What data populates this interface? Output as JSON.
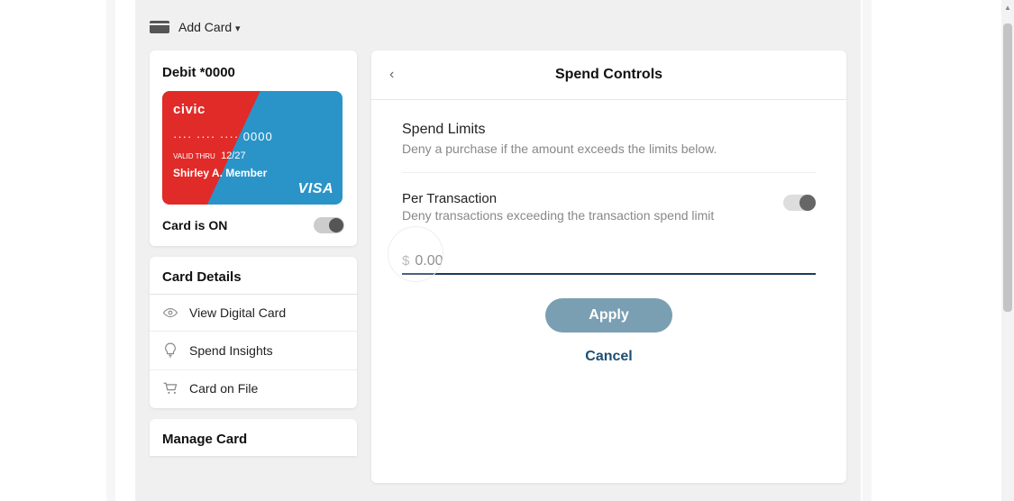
{
  "topbar": {
    "add_card_label": "Add Card"
  },
  "card": {
    "title": "Debit *0000",
    "brand": "civic",
    "number": "···· ···· ···· 0000",
    "valid_label": "VALID\nTHRU",
    "valid_thru": "12/27",
    "holder": "Shirley A. Member",
    "network": "VISA",
    "status_label": "Card is ON"
  },
  "details": {
    "title": "Card Details",
    "items": [
      {
        "label": "View Digital Card"
      },
      {
        "label": "Spend Insights"
      },
      {
        "label": "Card on File"
      }
    ]
  },
  "manage": {
    "title": "Manage Card"
  },
  "panel": {
    "title": "Spend Controls",
    "spend_limits_title": "Spend Limits",
    "spend_limits_sub": "Deny a purchase if the amount exceeds the limits below.",
    "per_tx_title": "Per Transaction",
    "per_tx_sub": "Deny transactions exceeding the transaction spend limit",
    "currency_symbol": "$",
    "amount_placeholder": "0.00",
    "apply_label": "Apply",
    "cancel_label": "Cancel"
  }
}
